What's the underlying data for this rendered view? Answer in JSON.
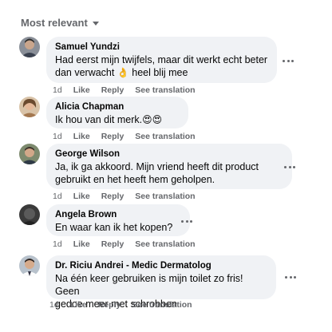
{
  "sort": {
    "label": "Most relevant"
  },
  "actions": {
    "like": "Like",
    "reply": "Reply",
    "translate": "See translation"
  },
  "comments": [
    {
      "author": "Samuel Yundzi",
      "text_before": "Had eerst mijn twijfels, maar dit werkt echt beter\ndan verwacht ",
      "emoji": "👌",
      "text_after": " heel blij mee",
      "time": "1d"
    },
    {
      "author": "Alicia Chapman",
      "text": "Ik hou van dit merk.",
      "emoji": "😍😍",
      "time": "1d"
    },
    {
      "author": "George Wilson",
      "text": "Ja, ik ga akkoord. Mijn vriend heeft dit product\ngebruikt en het heeft hem geholpen.",
      "time": "1d"
    },
    {
      "author": "Angela Brown",
      "text": "En waar kan ik het kopen?",
      "time": "1d"
    },
    {
      "author": "Dr. Riciu Andrei - Medic Dermatolog",
      "text": "Na één keer gebruiken is mijn toilet zo fris! Geen\ngedoe meer met schrobben",
      "time": "1d"
    }
  ]
}
